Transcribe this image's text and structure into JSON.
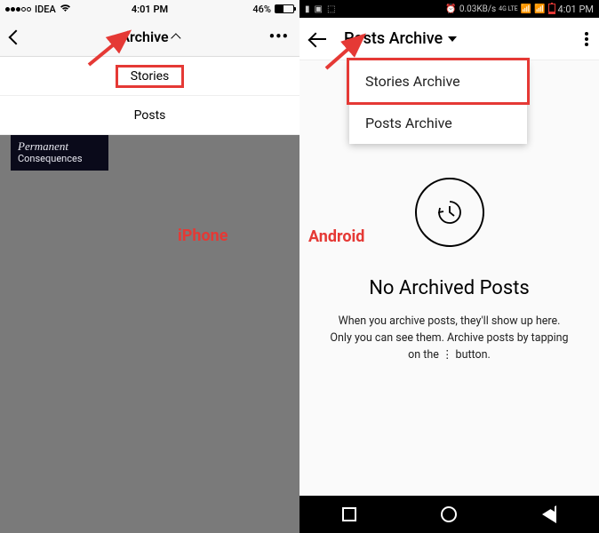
{
  "ios": {
    "status": {
      "carrier": "IDEA",
      "time": "4:01 PM",
      "battery": "46%"
    },
    "nav": {
      "title": "Archive"
    },
    "menu": {
      "stories": "Stories",
      "posts": "Posts"
    },
    "card": {
      "line1": "Permanent",
      "line2": "Consequences"
    },
    "label": "iPhone"
  },
  "android": {
    "status": {
      "speed": "0.03KB/s",
      "lte": "4G LTE",
      "time": "4:01 PM"
    },
    "nav": {
      "title": "Posts Archive"
    },
    "menu": {
      "stories": "Stories Archive",
      "posts": "Posts Archive"
    },
    "empty": {
      "heading": "No Archived Posts",
      "body": "When you archive posts, they'll show up here. Only you can see them. Archive posts by tapping on the  ⋮  button."
    },
    "label": "Android"
  }
}
